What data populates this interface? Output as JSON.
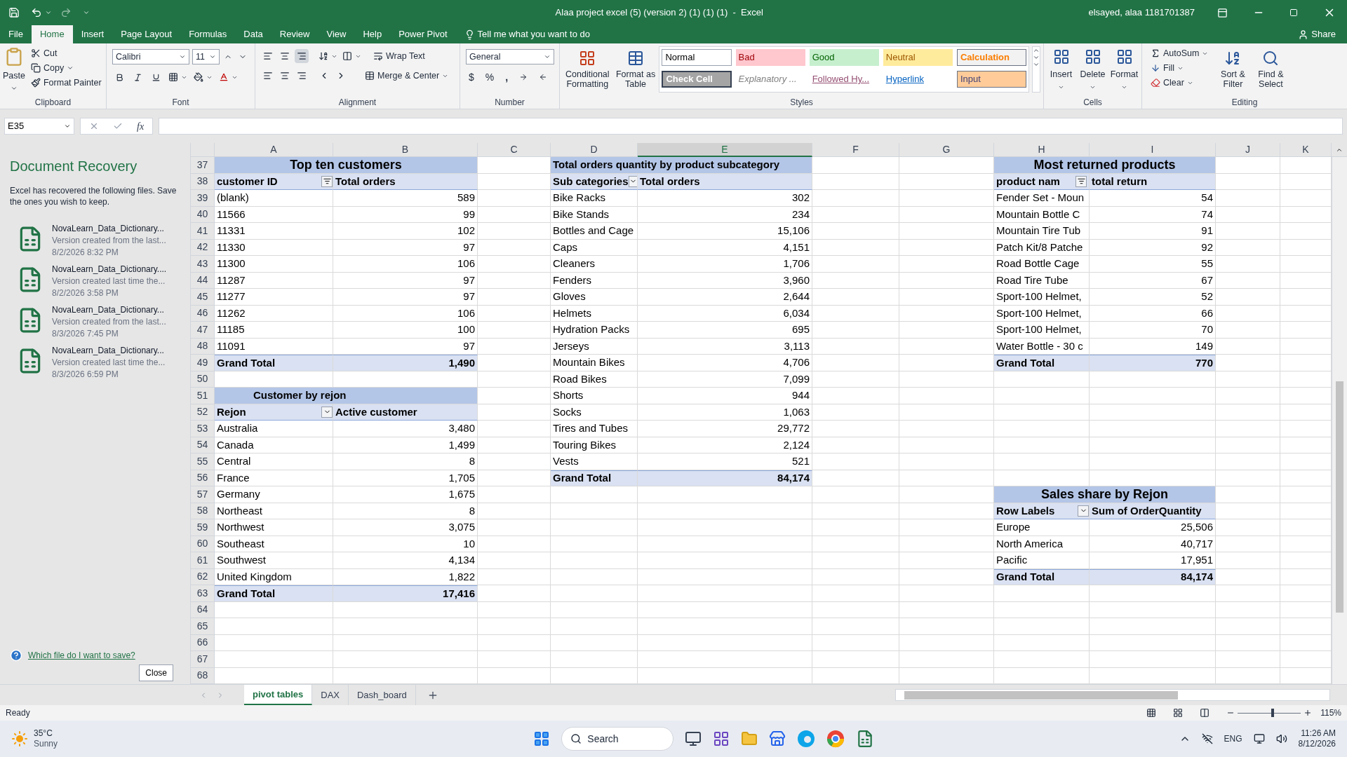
{
  "title_bar": {
    "title": "Alaa project excel (5) (version 2) (1) (1) (1)  -  Excel",
    "user": "elsayed, alaa 1181701387"
  },
  "menu_tabs": [
    {
      "label": "File",
      "selected": false
    },
    {
      "label": "Home",
      "selected": true
    },
    {
      "label": "Insert",
      "selected": false
    },
    {
      "label": "Page Layout",
      "selected": false
    },
    {
      "label": "Formulas",
      "selected": false
    },
    {
      "label": "Data",
      "selected": false
    },
    {
      "label": "Review",
      "selected": false
    },
    {
      "label": "View",
      "selected": false
    },
    {
      "label": "Help",
      "selected": false
    },
    {
      "label": "Power Pivot",
      "selected": false
    }
  ],
  "tell_me": "Tell me what you want to do",
  "share": "Share",
  "ribbon": {
    "clipboard": {
      "paste": "Paste",
      "cut": "Cut",
      "copy": "Copy",
      "format_painter": "Format Painter",
      "label": "Clipboard"
    },
    "font": {
      "name": "Calibri",
      "size": "11",
      "label": "Font"
    },
    "alignment": {
      "wrap": "Wrap Text",
      "merge": "Merge & Center",
      "label": "Alignment"
    },
    "number": {
      "format": "General",
      "currency": "$",
      "percent": "%",
      "comma": ",",
      "label": "Number"
    },
    "styles": {
      "conditional": "Conditional Formatting",
      "format_table": "Format as Table",
      "label": "Styles",
      "gallery": [
        {
          "label": "Normal",
          "kind": "normal"
        },
        {
          "label": "Bad",
          "kind": "bad"
        },
        {
          "label": "Good",
          "kind": "good"
        },
        {
          "label": "Neutral",
          "kind": "neutral"
        },
        {
          "label": "Calculation",
          "kind": "calculation"
        },
        {
          "label": "Check Cell",
          "kind": "check"
        },
        {
          "label": "Explanatory ...",
          "kind": "explanatory"
        },
        {
          "label": "Followed Hy...",
          "kind": "followed"
        },
        {
          "label": "Hyperlink",
          "kind": "hyperlink"
        },
        {
          "label": "Input",
          "kind": "input"
        }
      ]
    },
    "cells": {
      "buttons": [
        "Insert",
        "Delete",
        "Format"
      ],
      "label": "Cells"
    },
    "editing": {
      "autosum": "AutoSum",
      "fill": "Fill",
      "clear": "Clear",
      "sort": "Sort & Filter",
      "find": "Find & Select",
      "label": "Editing"
    }
  },
  "formula_bar": {
    "name_box": "E35",
    "function_label": "fx"
  },
  "recovery": {
    "title": "Document Recovery",
    "message": "Excel has recovered the following files.  Save the ones you wish to keep.",
    "files": [
      {
        "name": "NovaLearn_Data_Dictionary...",
        "description": "Version created from the last...",
        "time": "8/2/2026 8:32 PM"
      },
      {
        "name": "NovaLearn_Data_Dictionary....",
        "description": "Version created last time the...",
        "time": "8/2/2026 3:58 PM"
      },
      {
        "name": "NovaLearn_Data_Dictionary...",
        "description": "Version created from the last...",
        "time": "8/3/2026 7:45 PM"
      },
      {
        "name": "NovaLearn_Data_Dictionary...",
        "description": "Version created last time the...",
        "time": "8/3/2026 6:59 PM"
      }
    ],
    "help_link": "Which file do I want to save?",
    "close": "Close"
  },
  "sheet": {
    "columns": [
      {
        "letter": "A",
        "selected": false
      },
      {
        "letter": "B",
        "selected": false
      },
      {
        "letter": "C",
        "selected": false
      },
      {
        "letter": "D",
        "selected": false
      },
      {
        "letter": "E",
        "selected": true
      },
      {
        "letter": "F",
        "selected": false
      },
      {
        "letter": "G",
        "selected": false
      },
      {
        "letter": "H",
        "selected": false
      },
      {
        "letter": "I",
        "selected": false
      },
      {
        "letter": "J",
        "selected": false
      },
      {
        "letter": "K",
        "selected": false
      }
    ],
    "row_numbers": [
      "37",
      "38",
      "39",
      "40",
      "41",
      "42",
      "43",
      "44",
      "45",
      "46",
      "47",
      "48",
      "49",
      "50",
      "51",
      "52",
      "53",
      "54",
      "55",
      "56",
      "57",
      "58",
      "59",
      "60",
      "61",
      "62",
      "63",
      "64",
      "65",
      "66",
      "67",
      "68"
    ],
    "pivots": [
      {
        "title": "Top ten customers",
        "headers": [
          "customer ID",
          "Total orders"
        ],
        "kind": "sort_filter",
        "rows": [
          [
            "(blank)",
            "589"
          ],
          [
            "11566",
            "99"
          ],
          [
            "11331",
            "102"
          ],
          [
            "11330",
            "97"
          ],
          [
            "11300",
            "106"
          ],
          [
            "11287",
            "97"
          ],
          [
            "11277",
            "97"
          ],
          [
            "11262",
            "106"
          ],
          [
            "11185",
            "100"
          ],
          [
            "11091",
            "97"
          ]
        ],
        "total": [
          "Grand Total",
          "1,490"
        ]
      },
      {
        "title": "Total orders quantity by product subcategory",
        "headers": [
          "Sub categories",
          "Total orders"
        ],
        "kind": "dropdown",
        "rows": [
          [
            "Bike Racks",
            "302"
          ],
          [
            "Bike Stands",
            "234"
          ],
          [
            "Bottles and Cage",
            "15,106"
          ],
          [
            "Caps",
            "4,151"
          ],
          [
            "Cleaners",
            "1,706"
          ],
          [
            "Fenders",
            "3,960"
          ],
          [
            "Gloves",
            "2,644"
          ],
          [
            "Helmets",
            "6,034"
          ],
          [
            "Hydration Packs",
            "695"
          ],
          [
            "Jerseys",
            "3,113"
          ],
          [
            "Mountain Bikes",
            "4,706"
          ],
          [
            "Road Bikes",
            "7,099"
          ],
          [
            "Shorts",
            "944"
          ],
          [
            "Socks",
            "1,063"
          ],
          [
            "Tires and Tubes",
            "29,772"
          ],
          [
            "Touring Bikes",
            "2,124"
          ],
          [
            "Vests",
            "521"
          ]
        ],
        "total": [
          "Grand Total",
          "84,174"
        ]
      },
      {
        "title": "Most returned products",
        "headers": [
          "product nam",
          "total return"
        ],
        "kind": "sort_filter",
        "rows": [
          [
            "Fender Set - Moun",
            "54"
          ],
          [
            "Mountain Bottle C",
            "74"
          ],
          [
            "Mountain Tire Tub",
            "91"
          ],
          [
            "Patch Kit/8 Patche",
            "92"
          ],
          [
            "Road Bottle Cage",
            "55"
          ],
          [
            "Road Tire Tube",
            "67"
          ],
          [
            "Sport-100 Helmet,",
            "52"
          ],
          [
            "Sport-100 Helmet,",
            "66"
          ],
          [
            "Sport-100 Helmet,",
            "70"
          ],
          [
            "Water Bottle - 30 c",
            "149"
          ]
        ],
        "total": [
          "Grand Total",
          "770"
        ]
      },
      {
        "title": "Customer by rejon",
        "headers": [
          "Rejon",
          "Active customer"
        ],
        "kind": "dropdown",
        "rows": [
          [
            "Australia",
            "3,480"
          ],
          [
            "Canada",
            "1,499"
          ],
          [
            "Central",
            "8"
          ],
          [
            "France",
            "1,705"
          ],
          [
            "Germany",
            "1,675"
          ],
          [
            "Northeast",
            "8"
          ],
          [
            "Northwest",
            "3,075"
          ],
          [
            "Southeast",
            "10"
          ],
          [
            "Southwest",
            "4,134"
          ],
          [
            "United Kingdom",
            "1,822"
          ]
        ],
        "total": [
          "Grand Total",
          "17,416"
        ]
      },
      {
        "title": "Sales share by Rejon",
        "headers": [
          "Row Labels",
          "Sum of OrderQuantity"
        ],
        "kind": "dropdown",
        "rows": [
          [
            "Europe",
            "25,506"
          ],
          [
            "North America",
            "40,717"
          ],
          [
            "Pacific",
            "17,951"
          ]
        ],
        "total": [
          "Grand Total",
          "84,174"
        ]
      }
    ]
  },
  "sheet_tabs": [
    {
      "label": "pivot tables",
      "selected": true
    },
    {
      "label": "DAX",
      "selected": false
    },
    {
      "label": "Dash_board",
      "selected": false
    }
  ],
  "status_bar": {
    "status": "Ready",
    "zoom": "115%",
    "zoom_level": {
      "level": 0.55
    }
  },
  "taskbar": {
    "temperature": "35°C",
    "weather": "Sunny",
    "search": "Search",
    "language": "ENG",
    "time": "11:26 AM",
    "date": "8/12/2026"
  }
}
